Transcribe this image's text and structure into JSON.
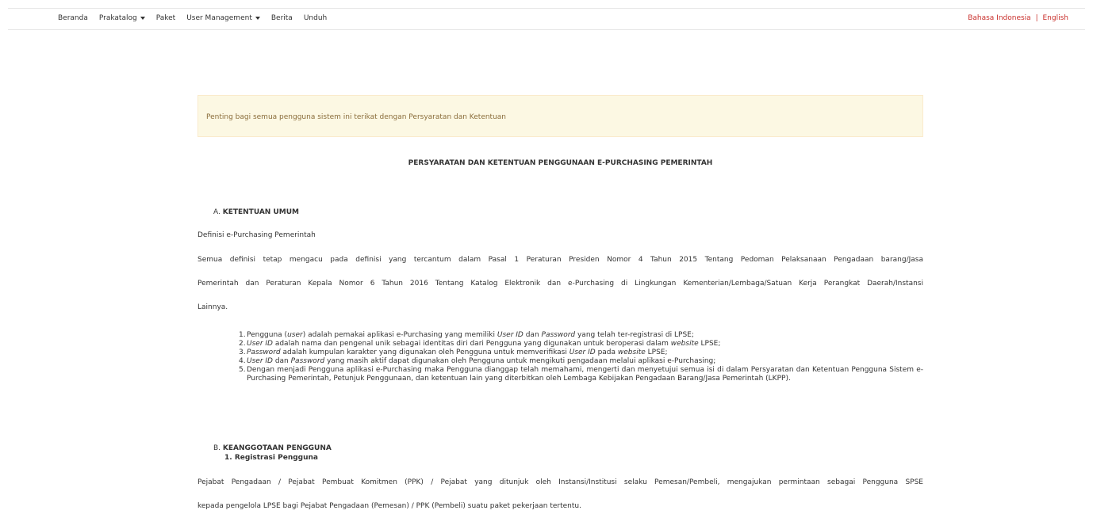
{
  "nav": {
    "items": [
      {
        "label": "Beranda",
        "dropdown": false
      },
      {
        "label": "Prakatalog",
        "dropdown": true
      },
      {
        "label": "Paket",
        "dropdown": false
      },
      {
        "label": "User Management",
        "dropdown": true
      },
      {
        "label": "Berita",
        "dropdown": false
      },
      {
        "label": "Unduh",
        "dropdown": false
      }
    ],
    "lang_id": "Bahasa Indonesia",
    "lang_sep": "|",
    "lang_en": "English",
    "lang_color": "#c9302c"
  },
  "alert": {
    "text": "Penting bagi semua pengguna sistem ini terikat dengan Persyaratan dan Ketentuan",
    "bg": "#fcf8e3"
  },
  "doc": {
    "title": "PERSYARATAN DAN KETENTUAN PENGGUNAAN E-PURCHASING PEMERINTAH",
    "section_a": {
      "prefix": "A.",
      "title": "KETENTUAN UMUM"
    },
    "definition_title": "Definisi e-Purchasing Pemerintah",
    "definition_lines": [
      "Semua definisi tetap mengacu pada definisi yang tercantum dalam Pasal 1 Peraturan Presiden Nomor 4 Tahun 2015 Tentang Pedoman Pelaksanaan Pengadaan barang/Jasa",
      "Pemerintah dan Peraturan Kepala Nomor 6 Tahun 2016 Tentang Katalog Elektronik dan e-Purchasing di Lingkungan Kementerian/Lembaga/Satuan Kerja Perangkat Daerah/Instansi",
      "Lainnya."
    ],
    "definitions": [
      {
        "num": "1.",
        "parts": [
          "Pengguna (",
          "user",
          ") adalah pemakai aplikasi e-Purchasing yang memiliki ",
          "User ID",
          " dan ",
          "Password",
          " yang telah ter-registrasi di LPSE;"
        ]
      },
      {
        "num": "2.",
        "parts": [
          "",
          "User ID",
          " adalah nama dan pengenal unik sebagai identitas diri dari Pengguna yang digunakan untuk beroperasi dalam ",
          "website",
          " LPSE;"
        ]
      },
      {
        "num": "3.",
        "parts": [
          "",
          "Password",
          " adalah kumpulan karakter yang digunakan oleh Pengguna untuk memverifikasi ",
          "User ID",
          " pada ",
          "website",
          " LPSE;"
        ]
      },
      {
        "num": "4.",
        "parts": [
          "",
          "User ID",
          " dan ",
          "Password",
          " yang masih aktif dapat digunakan oleh Pengguna untuk mengikuti pengadaan melalui aplikasi e-Purchasing;"
        ]
      },
      {
        "num": "5.",
        "parts": [
          "Dengan menjadi Pengguna aplikasi e-Purchasing maka Pengguna dianggap telah memahami, mengerti dan menyetujui semua isi di dalam Persyaratan dan Ketentuan Pengguna Sistem e-Purchasing Pemerintah, Petunjuk Penggunaan, dan ketentuan lain yang diterbitkan oleh Lembaga Kebijakan Pengadaan Barang/Jasa Pemerintah (LKPP)."
        ]
      }
    ],
    "section_b": {
      "prefix": "B.",
      "title": "KEANGGOTAAN PENGGUNA"
    },
    "sub_b1": "1. Registrasi Pengguna",
    "registration_lines": [
      "Pejabat Pengadaan / Pejabat Pembuat Komitmen (PPK) / Pejabat yang ditunjuk oleh Instansi/Institusi selaku Pemesan/Pembeli, mengajukan permintaan sebagai Pengguna SPSE",
      "kepada pengelola LPSE bagi Pejabat Pengadaan (Pemesan) / PPK (Pembeli) suatu paket pekerjaan tertentu."
    ]
  }
}
